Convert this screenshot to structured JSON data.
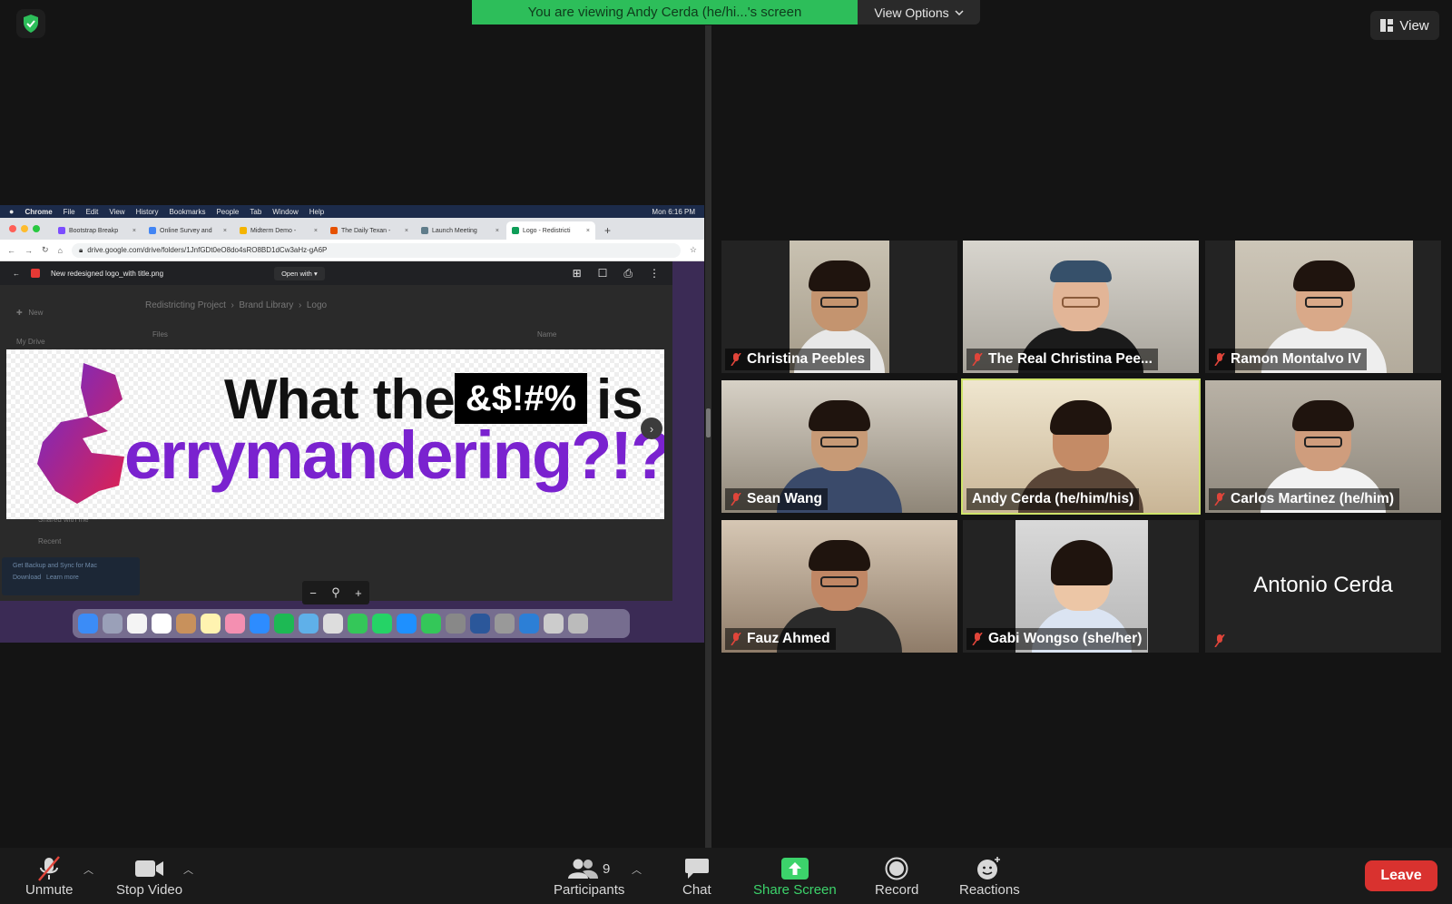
{
  "banner": {
    "viewing_text": "You are viewing Andy Cerda (he/hi...'s screen",
    "view_options_label": "View Options"
  },
  "view_button_label": "View",
  "shared_screen": {
    "mac_menu": [
      "Chrome",
      "File",
      "Edit",
      "View",
      "History",
      "Bookmarks",
      "People",
      "Tab",
      "Window",
      "Help"
    ],
    "clock": "Mon 6:16 PM",
    "tabs": [
      {
        "title": "Bootstrap Breakp",
        "color": "#7c4dff"
      },
      {
        "title": "Online Survey and",
        "color": "#4285f4"
      },
      {
        "title": "Midterm Demo -",
        "color": "#f4b400"
      },
      {
        "title": "The Daily Texan -",
        "color": "#e65100"
      },
      {
        "title": "Launch Meeting",
        "color": "#607d8b"
      },
      {
        "title": "Logo - Redistricti",
        "color": "#0f9d58"
      }
    ],
    "url": "drive.google.com/drive/folders/1JnfGDt0eO8do4sRO8BD1dCw3aHz-gA6P",
    "file_name": "New redesigned logo_with title.png",
    "open_with_label": "Open with",
    "breadcrumb": [
      "Redistricting Project",
      "Brand Library",
      "Logo"
    ],
    "bg_new_label": "New",
    "bg_my_drive": "My Drive",
    "bg_shared": "Shared with me",
    "bg_recent": "Recent",
    "bg_files": "Files",
    "bg_name": "Name",
    "promo_title": "Get Backup and Sync for Mac",
    "promo_download": "Download",
    "promo_learn": "Learn more",
    "logo": {
      "line1": "What the",
      "censor": "&$!#%",
      "is": "is",
      "line2": "errymandering?!?"
    },
    "zoom_glyphs": {
      "minus": "−",
      "mag": "⚲",
      "plus": "+"
    },
    "next_glyph": "›"
  },
  "participants": [
    {
      "name": "Christina Peebles",
      "muted": true
    },
    {
      "name": "The Real Christina Pee...",
      "muted": true
    },
    {
      "name": "Ramon Montalvo IV",
      "muted": true
    },
    {
      "name": "Sean Wang",
      "muted": true
    },
    {
      "name": "Andy Cerda (he/him/his)",
      "muted": false,
      "active": true
    },
    {
      "name": "Carlos Martinez (he/him)",
      "muted": true
    },
    {
      "name": "Fauz Ahmed",
      "muted": true
    },
    {
      "name": "Gabi Wongso (she/her)",
      "muted": true
    },
    {
      "name": "Antonio Cerda",
      "muted": true,
      "video_off": true
    }
  ],
  "toolbar": {
    "unmute_label": "Unmute",
    "stop_video_label": "Stop Video",
    "participants_label": "Participants",
    "participants_count": "9",
    "chat_label": "Chat",
    "share_screen_label": "Share Screen",
    "record_label": "Record",
    "reactions_label": "Reactions",
    "leave_label": "Leave"
  },
  "colors": {
    "banner_green": "#2dbe5a",
    "active_speaker_border": "#cfe46a",
    "leave_red": "#d9322f",
    "share_green": "#3cd36b",
    "muted_red": "#e0453a"
  }
}
